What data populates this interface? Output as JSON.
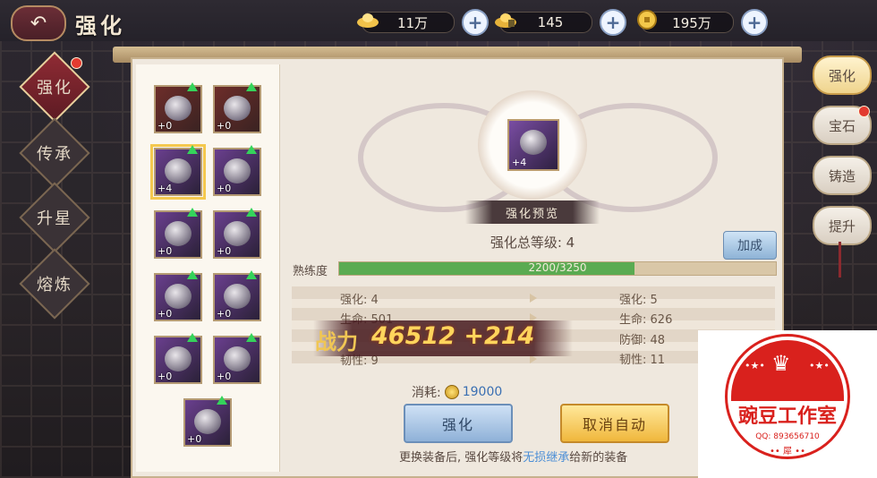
{
  "header": {
    "title": "强化",
    "back_icon": "back-arrow-icon"
  },
  "currencies": [
    {
      "name": "silver-ingot",
      "value": "11万"
    },
    {
      "name": "gold-ingot",
      "value": "145"
    },
    {
      "name": "coin",
      "value": "195万"
    }
  ],
  "left_tabs": [
    {
      "label": "强化",
      "active": true,
      "badge": true
    },
    {
      "label": "传承",
      "active": false,
      "badge": false
    },
    {
      "label": "升星",
      "active": false,
      "badge": false
    },
    {
      "label": "熔炼",
      "active": false,
      "badge": false
    }
  ],
  "equipment": [
    {
      "level": "+0",
      "upgradable": true,
      "rarity": "red"
    },
    {
      "level": "+0",
      "upgradable": true,
      "rarity": "red"
    },
    {
      "level": "+4",
      "upgradable": true,
      "rarity": "purple",
      "selected": true
    },
    {
      "level": "+0",
      "upgradable": true,
      "rarity": "purple"
    },
    {
      "level": "+0",
      "upgradable": true,
      "rarity": "purple"
    },
    {
      "level": "+0",
      "upgradable": true,
      "rarity": "purple"
    },
    {
      "level": "+0",
      "upgradable": true,
      "rarity": "purple"
    },
    {
      "level": "+0",
      "upgradable": true,
      "rarity": "purple"
    },
    {
      "level": "+0",
      "upgradable": true,
      "rarity": "purple"
    },
    {
      "level": "+0",
      "upgradable": true,
      "rarity": "purple"
    },
    {
      "level": "+0",
      "upgradable": true,
      "rarity": "purple"
    }
  ],
  "preview": {
    "item_level": "+4",
    "banner": "强化预览",
    "total_level": "强化总等级: 4",
    "bonus_button": "加成"
  },
  "proficiency": {
    "label": "熟练度",
    "text": "2200/3250",
    "current": 2200,
    "max": 3250
  },
  "stats_current": [
    {
      "label": "强化:",
      "value": "4"
    },
    {
      "label": "生命:",
      "value": "501"
    },
    {
      "label": "韧性:",
      "value": "9"
    }
  ],
  "stats_next": [
    {
      "label": "强化:",
      "value": "5"
    },
    {
      "label": "生命:",
      "value": "626"
    },
    {
      "label": "防御:",
      "value": "48"
    },
    {
      "label": "韧性:",
      "value": "11"
    }
  ],
  "power": {
    "label": "战力",
    "value": "46512 +214"
  },
  "cost": {
    "label": "消耗:",
    "value": "19000"
  },
  "buttons": {
    "enhance": "强化",
    "cancel_auto": "取消自动"
  },
  "tip": {
    "before": "更换装备后, 强化等级将",
    "highlight": "无损继承",
    "after": "给新的装备"
  },
  "right_tabs": [
    {
      "label": "强化",
      "active": true,
      "badge": false
    },
    {
      "label": "宝石",
      "active": false,
      "badge": true
    },
    {
      "label": "铸造",
      "active": false,
      "badge": false
    },
    {
      "label": "提升",
      "active": false,
      "badge": false
    }
  ],
  "watermark": {
    "name": "豌豆工作室",
    "qq": "QQ: 893656710",
    "bottom": "•• 犀 ••"
  }
}
